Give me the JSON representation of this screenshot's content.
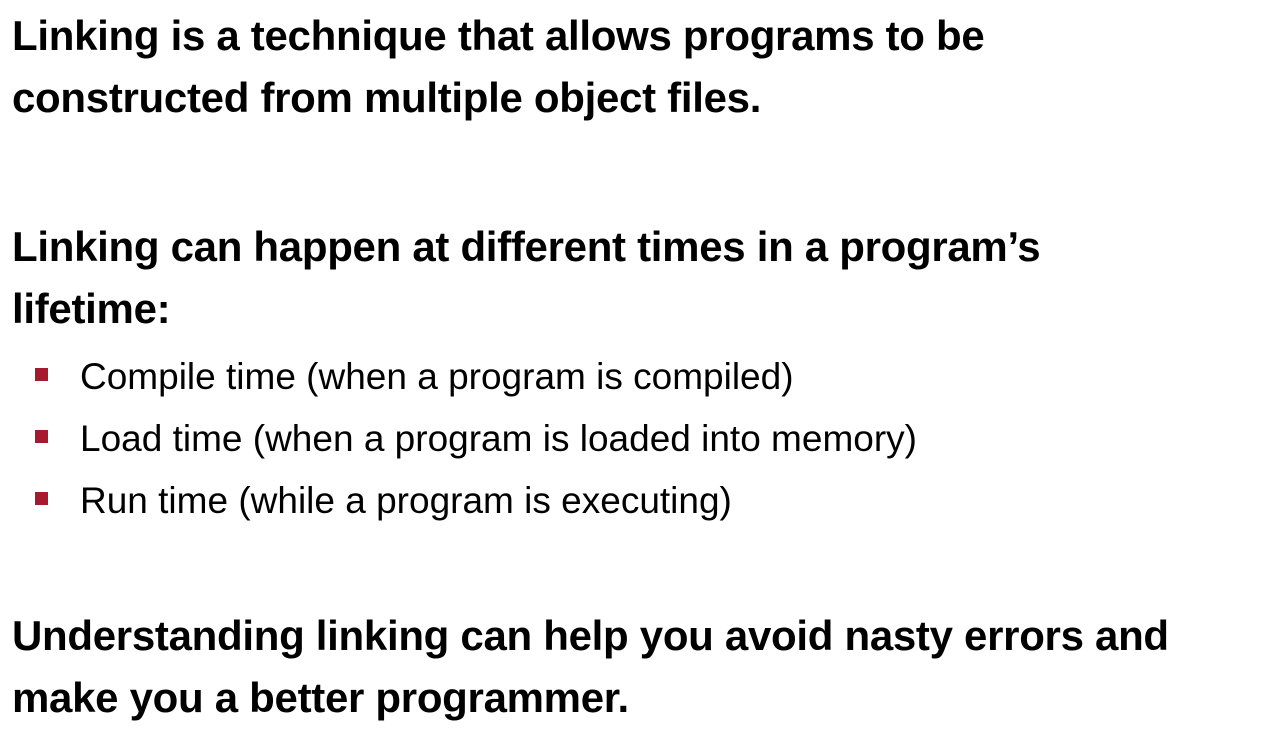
{
  "paragraphs": [
    {
      "lines": [
        "Linking is a technique that allows programs to be",
        "constructed from multiple object files."
      ]
    },
    {
      "lines": [
        "Linking can happen at different times in a program’s",
        "lifetime:"
      ]
    },
    {
      "lines": [
        "Understanding linking can help you avoid nasty errors and",
        "make you a better programmer."
      ]
    }
  ],
  "bullets": [
    {
      "text": "Compile time (when a program is compiled)"
    },
    {
      "text": "Load time (when a program is loaded into memory)"
    },
    {
      "text": "Run time (while a program is executing)"
    }
  ],
  "colors": {
    "text": "#000000",
    "bullet_marker": "#a6192e",
    "background": "#ffffff"
  },
  "icons": {
    "bullet_marker": "square-bullet-icon"
  }
}
